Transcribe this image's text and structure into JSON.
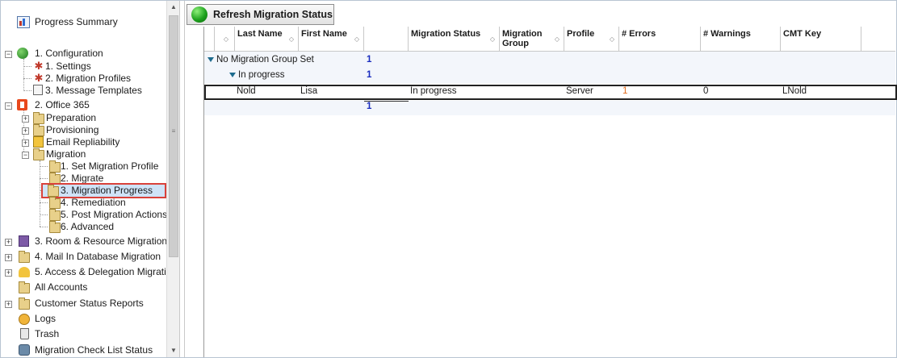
{
  "tree": {
    "progress_summary": "Progress Summary",
    "configuration": "1. Configuration",
    "settings": "1. Settings",
    "migration_profiles": "2. Migration Profiles",
    "message_templates": "3. Message Templates",
    "office365": "2. Office 365",
    "preparation": "Preparation",
    "provisioning": "Provisioning",
    "email_repliability": "Email Repliability",
    "migration": "Migration",
    "set_migration_profile": "1. Set Migration Profile",
    "migrate": "2. Migrate",
    "migration_progress": "3. Migration Progress",
    "remediation": "4. Remediation",
    "post_migration_actions": "5. Post Migration Actions",
    "advanced": "6. Advanced",
    "room_resource": "3. Room & Resource Migration",
    "mail_in_db": "4. Mail In Database Migration",
    "access_delegation": "5. Access & Delegation Migrati",
    "all_accounts": "All Accounts",
    "customer_status_reports": "Customer Status Reports",
    "logs": "Logs",
    "trash": "Trash",
    "migration_checklist": "Migration Check List Status"
  },
  "toolbar": {
    "refresh_label": "Refresh Migration Status"
  },
  "grid": {
    "columns": {
      "last_name": "Last Name",
      "first_name": "First Name",
      "migration_status": "Migration Status",
      "migration_group_1": "Migration",
      "migration_group_2": "Group",
      "profile": "Profile",
      "errors": "# Errors",
      "warnings": "# Warnings",
      "cmt_key": "CMT Key"
    },
    "group1": {
      "label": "No Migration Group Set",
      "count": "1"
    },
    "group2": {
      "label": "In progress",
      "count": "1"
    },
    "row": {
      "last_name": "Nold",
      "first_name": "Lisa",
      "migration_status": "In progress",
      "profile": "Server",
      "errors": "1",
      "warnings": "0",
      "cmt_key": "LNold"
    },
    "total_count": "1"
  },
  "colors": {
    "selection_outline": "#d9413a",
    "count_blue": "#1a2dbf",
    "error_orange": "#e06a1a"
  }
}
